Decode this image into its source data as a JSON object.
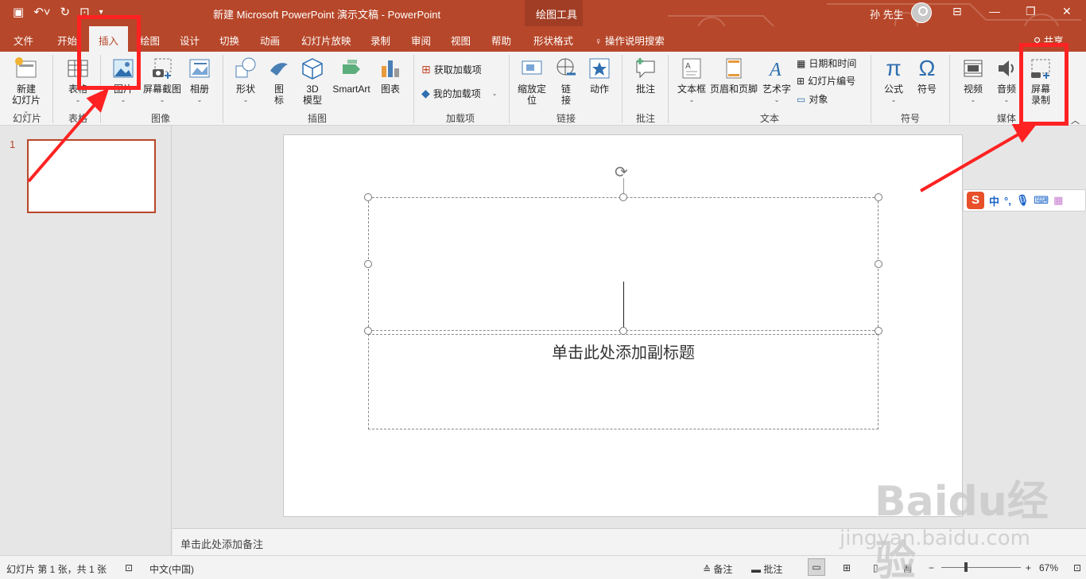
{
  "window": {
    "title": "新建 Microsoft PowerPoint 演示文稿  -  PowerPoint",
    "tool_context": "绘图工具",
    "user": "孙 先生"
  },
  "tabs": [
    {
      "label": "文件"
    },
    {
      "label": "开始"
    },
    {
      "label": "插入"
    },
    {
      "label": "绘图"
    },
    {
      "label": "设计"
    },
    {
      "label": "切换"
    },
    {
      "label": "动画"
    },
    {
      "label": "幻灯片放映"
    },
    {
      "label": "录制"
    },
    {
      "label": "审阅"
    },
    {
      "label": "视图"
    },
    {
      "label": "帮助"
    },
    {
      "label": "形状格式"
    }
  ],
  "active_tab": "插入",
  "tell_me": "操作说明搜索",
  "share": "共享",
  "ribbon": {
    "slides": {
      "new_slide": "新建\n幻灯片",
      "group": "幻灯片"
    },
    "tables": {
      "table": "表格",
      "group": "表格"
    },
    "images": {
      "pictures": "图片",
      "screenshot": "屏幕截图",
      "album": "相册",
      "group": "图像"
    },
    "illustrations": {
      "shapes": "形状",
      "icons": "图\n标",
      "model3d": "3D\n模型",
      "smartart": "SmartArt",
      "chart": "图表",
      "group": "插图"
    },
    "addins": {
      "get": "获取加载项",
      "mine": "我的加载项",
      "group": "加载项"
    },
    "links": {
      "zoom": "缩放定\n位",
      "link": "链\n接",
      "action": "动作",
      "group": "链接"
    },
    "comments": {
      "comment": "批注",
      "group": "批注"
    },
    "text": {
      "textbox": "文本框",
      "header_footer": "页眉和页脚",
      "wordart": "艺术字",
      "datetime": "日期和时间",
      "slide_number": "幻灯片编号",
      "object": "对象",
      "group": "文本"
    },
    "symbols": {
      "equation": "公式",
      "symbol": "符号",
      "group": "符号"
    },
    "media": {
      "video": "视频",
      "audio": "音频",
      "screen_recording": "屏幕\n录制",
      "group": "媒体"
    }
  },
  "thumbnails": [
    {
      "number": "1"
    }
  ],
  "slide": {
    "subtitle_placeholder": "单击此处添加副标题"
  },
  "notes_placeholder": "单击此处添加备注",
  "status": {
    "slide_info": "幻灯片 第 1 张，共 1 张",
    "language": "中文(中国)",
    "notes": "备注",
    "comments": "批注",
    "zoom": "67%"
  },
  "ime": {
    "mode": "中",
    "punct": "°,"
  },
  "watermark": {
    "line1": "Baidu经验",
    "line2": "jingyan.baidu.com"
  },
  "colors": {
    "accent": "#b7472a",
    "annotation": "#ff2222"
  }
}
